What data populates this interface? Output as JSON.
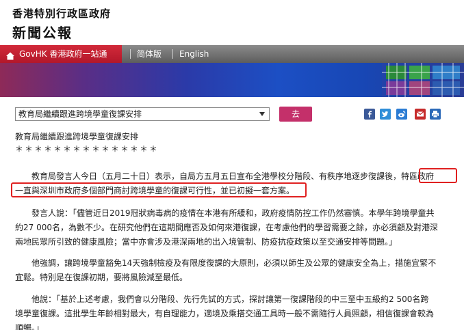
{
  "masthead": {
    "gov_name": "香港特別行政區政府",
    "press_title": "新聞公報"
  },
  "nav": {
    "govhk": "GovHK 香港政府一站通",
    "simplified": "简体版",
    "english": "English"
  },
  "toolbar": {
    "select_value": "教育局繼續跟進跨境學童復課安排",
    "go_label": "去",
    "share_icons": [
      "facebook-icon",
      "twitter-icon",
      "weibo-icon",
      "email-icon",
      "print-icon"
    ]
  },
  "article": {
    "title": "教育局繼續跟進跨境學童復課安排",
    "stars": "＊＊＊＊＊＊＊＊＊＊＊＊＊＊＊",
    "p1": {
      "l1a": "　　教育局發言人今日（五月二十日）表示，自局方五月五日宣布全港學校分階段、有秩序地逐步復課後，",
      "l1b": "特區政府",
      "l2": "一直與深圳市政府多個部門商討跨境學童的復課可行性，並已初擬一套方案。"
    },
    "p2": {
      "l1": "　　發言人說：「儘管近日2019冠狀病毒病的疫情在本港有所緩和，政府疫情防控工作仍然審慎。本學年跨境學童共",
      "l2": "約27 000名，為數不少。在研究他們在這期間應否及如何來港復課，在考慮他們的學習需要之餘，亦必須顧及對港深",
      "l3": "兩地民眾所引致的健康風險；當中亦會涉及港深兩地的出入境管制、防疫抗疫政策以至交通安排等問題。」"
    },
    "p3": {
      "l1": "　　他強調，讓跨境學童豁免14天強制檢疫及有限度復課的大原則，必須以師生及公眾的健康安全為上，措施宜緊不",
      "l2": "宜鬆。特別是在復課初期，要將風險減至最低。"
    },
    "p4": {
      "l1": "　　他說：「基於上述考慮，我們會以分階段、先行先試的方式，探討讓第一復課階段的中三至中五級約2 500名跨",
      "l2": "境學童復課。這批學生年齡相對最大，有自理能力，適境及乘搭交通工具時一般不需隨行人員照顧，相信復課會較為",
      "l3": "順暢。」"
    }
  },
  "colors": {
    "govhk_red": "#c21f33",
    "go_button": "#c4306a",
    "highlight_border": "#e02020"
  }
}
